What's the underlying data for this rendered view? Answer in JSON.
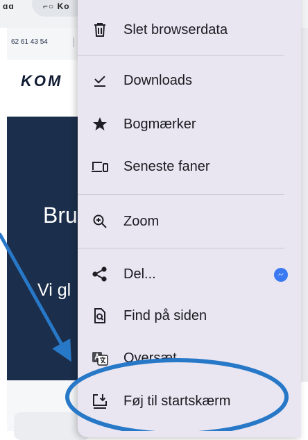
{
  "background_page": {
    "top_glyphs": "ɑɑ",
    "tab_text": "⌐○ Ko",
    "phone": "62 61 43 54",
    "logo": "KOM",
    "hero_title": "Bru",
    "hero_subtitle": "Vi gl"
  },
  "menu": {
    "items": [
      {
        "label": "Slet browserdata",
        "icon": "trash-icon"
      },
      {
        "label": "Downloads",
        "icon": "download-check-icon"
      },
      {
        "label": "Bogmærker",
        "icon": "star-icon"
      },
      {
        "label": "Seneste faner",
        "icon": "devices-icon"
      },
      {
        "label": "Zoom",
        "icon": "zoom-icon"
      },
      {
        "label": "Del...",
        "icon": "share-icon",
        "extra_icon": "messenger-icon"
      },
      {
        "label": "Find på siden",
        "icon": "find-in-page-icon"
      },
      {
        "label": "Oversæt...",
        "icon": "translate-icon"
      },
      {
        "label": "Føj til startskærm",
        "icon": "add-to-home-icon"
      }
    ]
  },
  "colors": {
    "menu_bg": "#e9e6f1",
    "annotation": "#2878c8",
    "hero_bg": "#1b2e4b",
    "messenger": "#3a79f2"
  }
}
